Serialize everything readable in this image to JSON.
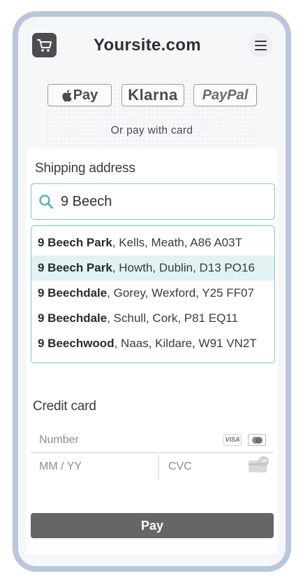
{
  "header": {
    "site_title": "Yoursite.com",
    "logo_icon": "shopping-cart-icon",
    "menu_icon": "hamburger-menu-icon"
  },
  "payment_options": {
    "apple_pay_label": "Pay",
    "klarna_label": "Klarna",
    "paypal_label": "PayPal",
    "or_text": "Or pay with card"
  },
  "shipping": {
    "label": "Shipping address",
    "search_value": "9 Beech",
    "suggestions": [
      {
        "match": "9 Beech Park",
        "rest": ", Kells, Meath, A86 A03T"
      },
      {
        "match": "9 Beech Park",
        "rest": ", Howth, Dublin, D13 PO16"
      },
      {
        "match": "9 Beechdale",
        "rest": ", Gorey, Wexford, Y25 FF07"
      },
      {
        "match": "9 Beechdale",
        "rest": ", Schull, Cork, P81 EQ11"
      },
      {
        "match": "9 Beechwood",
        "rest": ", Naas, Kildare, W91 VN2T"
      }
    ],
    "active_index": 1
  },
  "credit_card": {
    "label": "Credit card",
    "number_placeholder": "Number",
    "expiry_placeholder": "MM / YY",
    "cvc_placeholder": "CVC",
    "visa_text": "VISA",
    "cvc_badge": "135"
  },
  "pay_button_label": "Pay",
  "colors": {
    "accent_border": "#7fc2c7",
    "active_row": "#e2f2f3",
    "pay_button": "#656668",
    "frame": "#b9c6db"
  }
}
